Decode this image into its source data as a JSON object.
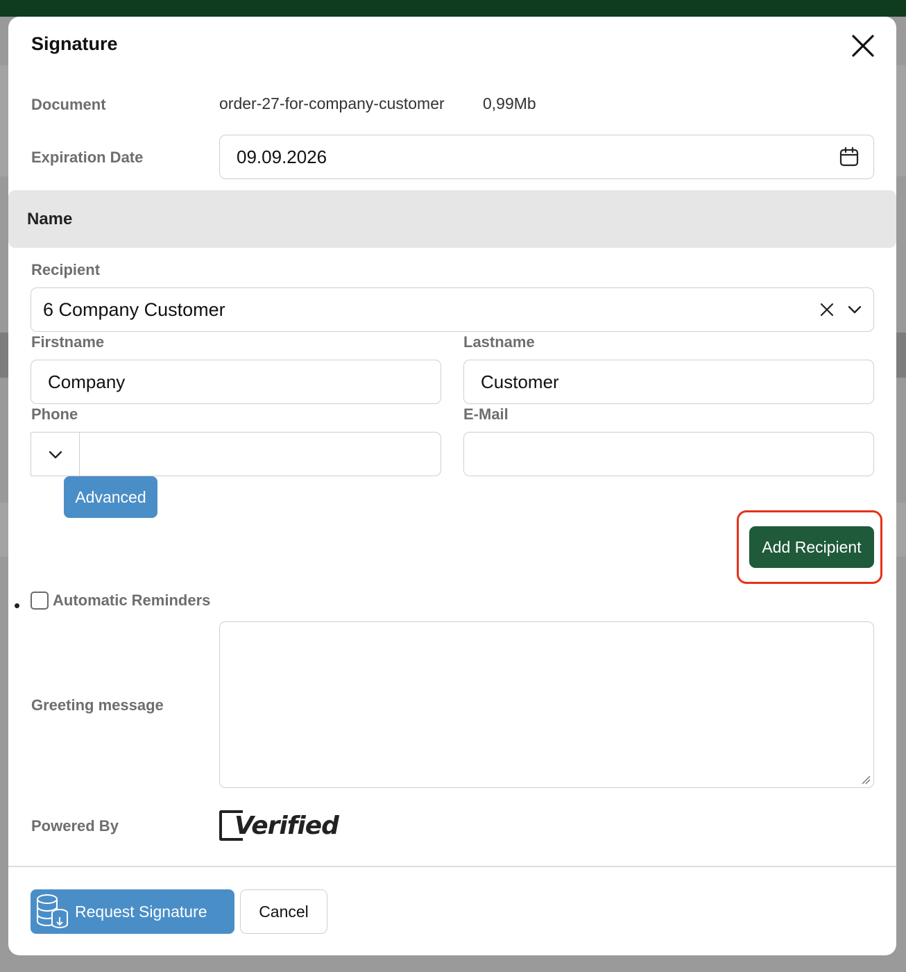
{
  "modal": {
    "title": "Signature",
    "document": {
      "label": "Document",
      "name": "order-27-for-company-customer",
      "size": "0,99Mb"
    },
    "expiration": {
      "label": "Expiration Date",
      "value": "09.09.2026"
    },
    "name_section": {
      "title": "Name"
    },
    "recipient": {
      "label": "Recipient",
      "selected": "6 Company Customer",
      "firstname": {
        "label": "Firstname",
        "value": "Company"
      },
      "lastname": {
        "label": "Lastname",
        "value": "Customer"
      },
      "phone": {
        "label": "Phone",
        "value": ""
      },
      "email": {
        "label": "E-Mail",
        "value": ""
      },
      "advanced_label": "Advanced",
      "add_label": "Add Recipient"
    },
    "reminders": {
      "label": "Automatic Reminders",
      "checked": false
    },
    "greeting": {
      "label": "Greeting message",
      "value": ""
    },
    "powered_by": {
      "label": "Powered By",
      "brand": "Verified"
    },
    "footer": {
      "request_label": "Request Signature",
      "cancel_label": "Cancel"
    }
  },
  "colors": {
    "topbar": "#0f3b1f",
    "primary_blue": "#4a8ec8",
    "primary_green": "#1f5a3a",
    "highlight_red": "#e53218"
  },
  "icons": [
    "close-icon",
    "calendar-icon",
    "clear-icon",
    "chevron-down-icon",
    "database-icon"
  ]
}
